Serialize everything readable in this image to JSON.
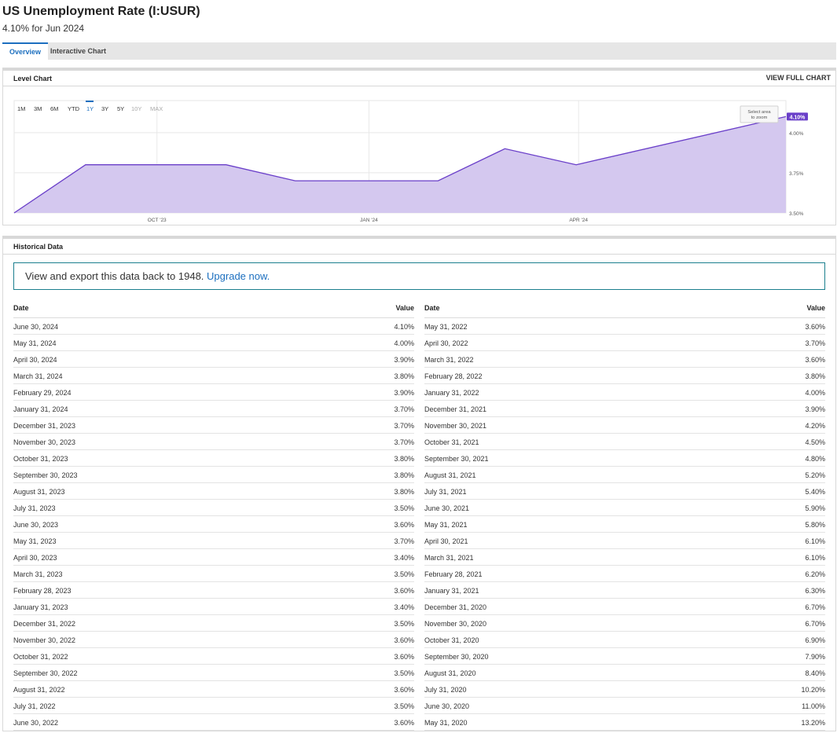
{
  "header": {
    "title": "US Unemployment Rate (I:USUR)",
    "subtitle": "4.10% for Jun 2024"
  },
  "tabs": [
    {
      "label": "Overview",
      "active": true
    },
    {
      "label": "Interactive Chart",
      "active": false
    }
  ],
  "level_chart": {
    "title": "Level Chart",
    "link": "VIEW FULL CHART",
    "zoom_hint": [
      "Select area",
      "to zoom"
    ],
    "ranges": [
      {
        "label": "1M",
        "state": "normal"
      },
      {
        "label": "3M",
        "state": "normal"
      },
      {
        "label": "6M",
        "state": "normal"
      },
      {
        "label": "YTD",
        "state": "normal"
      },
      {
        "label": "1Y",
        "state": "active"
      },
      {
        "label": "3Y",
        "state": "normal"
      },
      {
        "label": "5Y",
        "state": "normal"
      },
      {
        "label": "10Y",
        "state": "disabled"
      },
      {
        "label": "MAX",
        "state": "disabled"
      }
    ],
    "colors": {
      "line": "#6a3fc9",
      "fill": "#d4c8ef",
      "badge": "#6a3fc9",
      "active_range": "#1c6fbf"
    }
  },
  "chart_data": {
    "type": "area",
    "x": [
      "2023-06-30",
      "2023-07-31",
      "2023-08-31",
      "2023-09-30",
      "2023-10-31",
      "2023-11-30",
      "2023-12-31",
      "2024-01-31",
      "2024-02-29",
      "2024-03-31",
      "2024-04-30",
      "2024-05-31",
      "2024-06-30"
    ],
    "values": [
      3.6,
      3.5,
      3.8,
      3.8,
      3.8,
      3.7,
      3.7,
      3.7,
      3.9,
      3.8,
      3.9,
      4.0,
      4.1
    ],
    "plotted": [
      3.5,
      3.8,
      3.8,
      3.8,
      3.7,
      3.7,
      3.7,
      3.9,
      3.8,
      4.1
    ],
    "plotted_x": [
      "2023-07-31",
      "2023-08-31",
      "2023-09-30",
      "2023-10-31",
      "2023-11-30",
      "2023-12-31",
      "2024-01-31",
      "2024-02-29",
      "2024-03-31",
      "2024-06-30"
    ],
    "x_ticks": [
      {
        "label": "OCT '23",
        "x": "2023-10-01"
      },
      {
        "label": "JAN '24",
        "x": "2024-01-01"
      },
      {
        "label": "APR '24",
        "x": "2024-04-01"
      }
    ],
    "y_ticks": [
      {
        "label": "3.50%",
        "value": 3.5
      },
      {
        "label": "3.75%",
        "value": 3.75
      },
      {
        "label": "4.00%",
        "value": 4.0
      }
    ],
    "ylim": [
      3.5,
      4.2
    ],
    "last_label": "4.10%",
    "grid": true
  },
  "historical": {
    "title": "Historical Data",
    "upgrade_text": "View and export this data back to 1948.",
    "upgrade_link": "Upgrade now.",
    "col_date": "Date",
    "col_value": "Value",
    "left": [
      [
        "June 30, 2024",
        "4.10%"
      ],
      [
        "May 31, 2024",
        "4.00%"
      ],
      [
        "April 30, 2024",
        "3.90%"
      ],
      [
        "March 31, 2024",
        "3.80%"
      ],
      [
        "February 29, 2024",
        "3.90%"
      ],
      [
        "January 31, 2024",
        "3.70%"
      ],
      [
        "December 31, 2023",
        "3.70%"
      ],
      [
        "November 30, 2023",
        "3.70%"
      ],
      [
        "October 31, 2023",
        "3.80%"
      ],
      [
        "September 30, 2023",
        "3.80%"
      ],
      [
        "August 31, 2023",
        "3.80%"
      ],
      [
        "July 31, 2023",
        "3.50%"
      ],
      [
        "June 30, 2023",
        "3.60%"
      ],
      [
        "May 31, 2023",
        "3.70%"
      ],
      [
        "April 30, 2023",
        "3.40%"
      ],
      [
        "March 31, 2023",
        "3.50%"
      ],
      [
        "February 28, 2023",
        "3.60%"
      ],
      [
        "January 31, 2023",
        "3.40%"
      ],
      [
        "December 31, 2022",
        "3.50%"
      ],
      [
        "November 30, 2022",
        "3.60%"
      ],
      [
        "October 31, 2022",
        "3.60%"
      ],
      [
        "September 30, 2022",
        "3.50%"
      ],
      [
        "August 31, 2022",
        "3.60%"
      ],
      [
        "July 31, 2022",
        "3.50%"
      ],
      [
        "June 30, 2022",
        "3.60%"
      ]
    ],
    "right": [
      [
        "May 31, 2022",
        "3.60%"
      ],
      [
        "April 30, 2022",
        "3.70%"
      ],
      [
        "March 31, 2022",
        "3.60%"
      ],
      [
        "February 28, 2022",
        "3.80%"
      ],
      [
        "January 31, 2022",
        "4.00%"
      ],
      [
        "December 31, 2021",
        "3.90%"
      ],
      [
        "November 30, 2021",
        "4.20%"
      ],
      [
        "October 31, 2021",
        "4.50%"
      ],
      [
        "September 30, 2021",
        "4.80%"
      ],
      [
        "August 31, 2021",
        "5.20%"
      ],
      [
        "July 31, 2021",
        "5.40%"
      ],
      [
        "June 30, 2021",
        "5.90%"
      ],
      [
        "May 31, 2021",
        "5.80%"
      ],
      [
        "April 30, 2021",
        "6.10%"
      ],
      [
        "March 31, 2021",
        "6.10%"
      ],
      [
        "February 28, 2021",
        "6.20%"
      ],
      [
        "January 31, 2021",
        "6.30%"
      ],
      [
        "December 31, 2020",
        "6.70%"
      ],
      [
        "November 30, 2020",
        "6.70%"
      ],
      [
        "October 31, 2020",
        "6.90%"
      ],
      [
        "September 30, 2020",
        "7.90%"
      ],
      [
        "August 31, 2020",
        "8.40%"
      ],
      [
        "July 31, 2020",
        "10.20%"
      ],
      [
        "June 30, 2020",
        "11.00%"
      ],
      [
        "May 31, 2020",
        "13.20%"
      ]
    ]
  }
}
